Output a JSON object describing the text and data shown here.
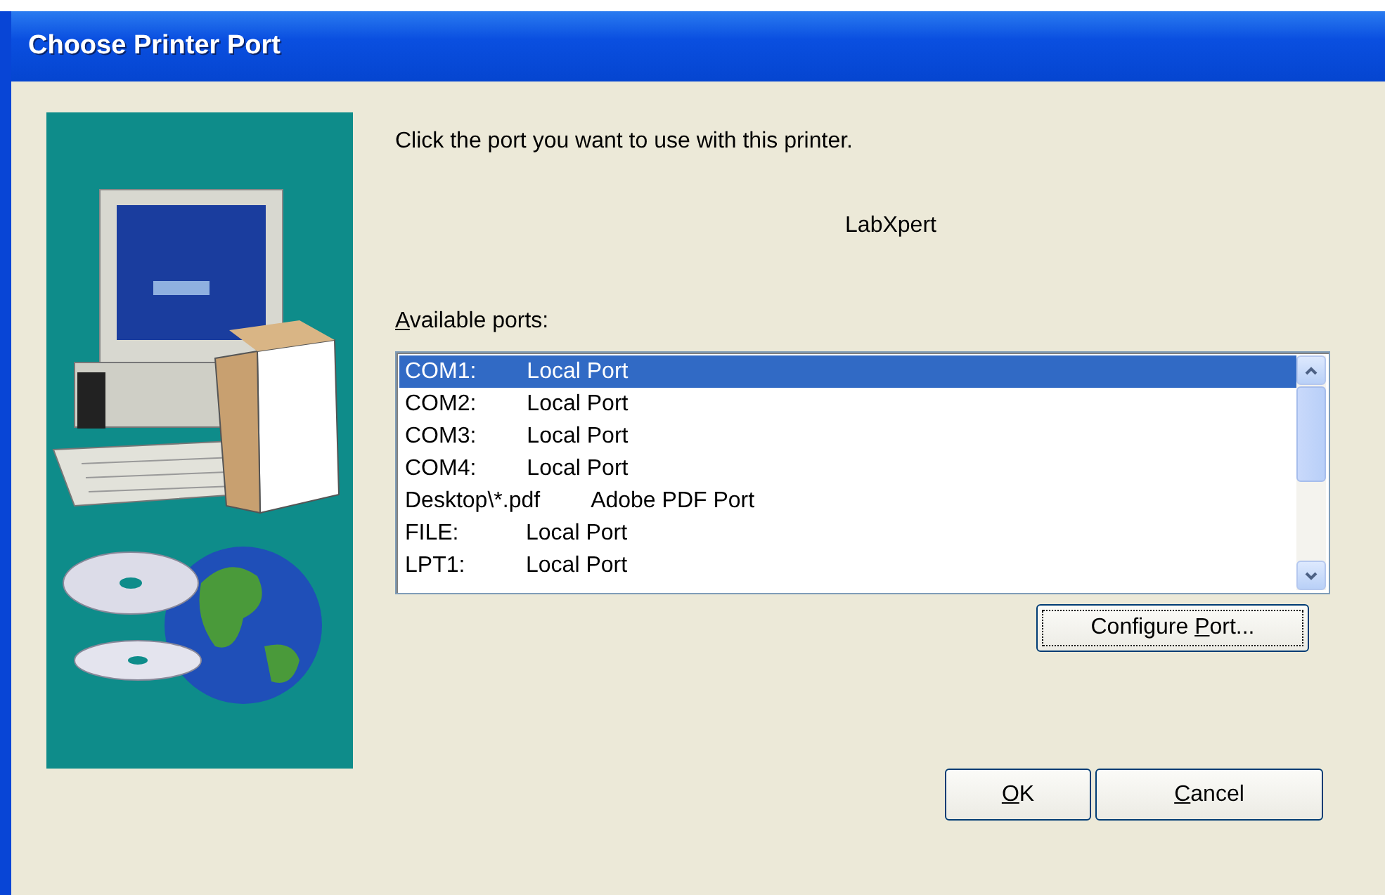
{
  "window": {
    "title": "Choose Printer Port"
  },
  "instruction": "Click the port you want to use with this printer.",
  "printer_name": "LabXpert",
  "ports_label": {
    "access_key": "A",
    "after": "vailable ports:"
  },
  "ports": [
    {
      "port": "COM1:",
      "description": "Local Port",
      "selected": true
    },
    {
      "port": "COM2:",
      "description": "Local Port",
      "selected": false
    },
    {
      "port": "COM3:",
      "description": "Local Port",
      "selected": false
    },
    {
      "port": "COM4:",
      "description": "Local Port",
      "selected": false
    },
    {
      "port": "Desktop\\*.pdf",
      "description": "Adobe PDF Port",
      "selected": false
    },
    {
      "port": "FILE:",
      "description": "Local Port",
      "selected": false
    },
    {
      "port": "LPT1:",
      "description": "Local Port",
      "selected": false
    }
  ],
  "configure_button": {
    "before": "Configure ",
    "access_key": "P",
    "after": "ort...",
    "focused": true
  },
  "buttons": [
    {
      "access_key": "O",
      "after": "K"
    },
    {
      "access_key": "C",
      "after": "ancel"
    }
  ]
}
